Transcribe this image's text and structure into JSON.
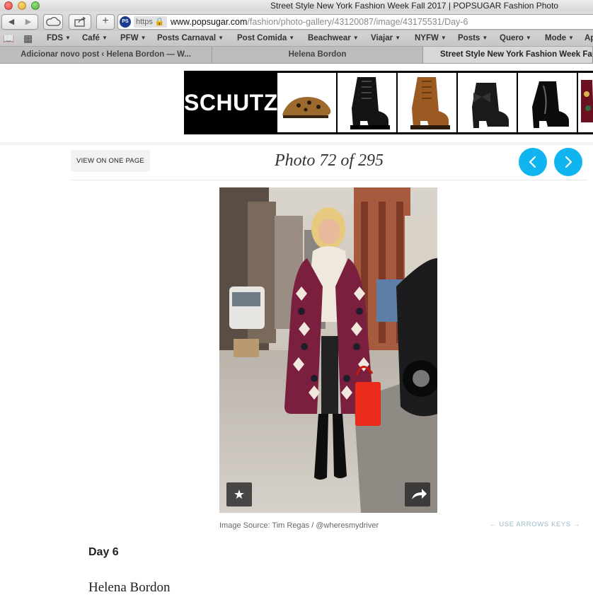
{
  "window": {
    "title": "Street Style New York Fashion Week Fall 2017 | POPSUGAR Fashion Photo"
  },
  "toolbar": {
    "back_icon": "back-arrow-icon",
    "forward_icon": "forward-arrow-icon",
    "cloud_icon": "cloud-icon",
    "share_icon": "share-icon",
    "plus_label": "+",
    "favicon_text": "PS",
    "https_label": "https",
    "url_host": "www.popsugar.com",
    "url_path": "/fashion/photo-gallery/43120087/image/43175531/Day-6"
  },
  "bookmarks": {
    "items": [
      {
        "label": "FDS"
      },
      {
        "label": "Café"
      },
      {
        "label": "PFW"
      },
      {
        "label": "Posts Carnaval"
      },
      {
        "label": "Post Comida"
      },
      {
        "label": "Beachwear"
      },
      {
        "label": "Viajar"
      },
      {
        "label": "NYFW"
      },
      {
        "label": "Posts"
      },
      {
        "label": "Quero"
      },
      {
        "label": "Mode"
      },
      {
        "label": "Ap"
      }
    ]
  },
  "tabs": [
    {
      "label": "Adicionar novo post ‹ Helena Bordon — W..."
    },
    {
      "label": "Helena Bordon"
    },
    {
      "label": "Street Style New York Fashion Week Fa"
    }
  ],
  "ad": {
    "brand": "SCHUTZ"
  },
  "gallery": {
    "view_one_page": "VIEW ON ONE PAGE",
    "photo_count": "Photo 72 of 295",
    "image_source": "Image Source: Tim Regas / @wheresmydriver",
    "keys_hint": "← USE ARROWS KEYS →",
    "favorite_glyph": "★"
  },
  "caption": {
    "day": "Day 6",
    "name": "Helena Bordon"
  },
  "colors": {
    "accent": "#10b5f0",
    "coat": "#7a1f3d"
  }
}
